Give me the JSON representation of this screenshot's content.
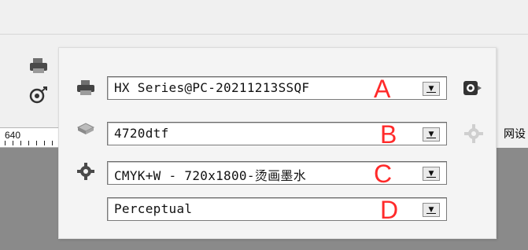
{
  "ruler": {
    "label": "640"
  },
  "side_text": "网设",
  "rows": [
    {
      "value": "HX Series@PC-20211213SSQF",
      "marker": "A",
      "icon": "printer-icon",
      "right_icon": "camera-icon"
    },
    {
      "value": "4720dtf",
      "marker": "B",
      "icon": "media-icon",
      "right_icon": "gear-icon-disabled"
    },
    {
      "value": "CMYK+W - 720x1800-烫画墨水",
      "marker": "C",
      "icon": "gear-icon",
      "right_icon": null
    },
    {
      "value": "Perceptual",
      "marker": "D",
      "icon": null,
      "right_icon": null
    }
  ],
  "colors": {
    "marker": "#ff2a2a"
  }
}
